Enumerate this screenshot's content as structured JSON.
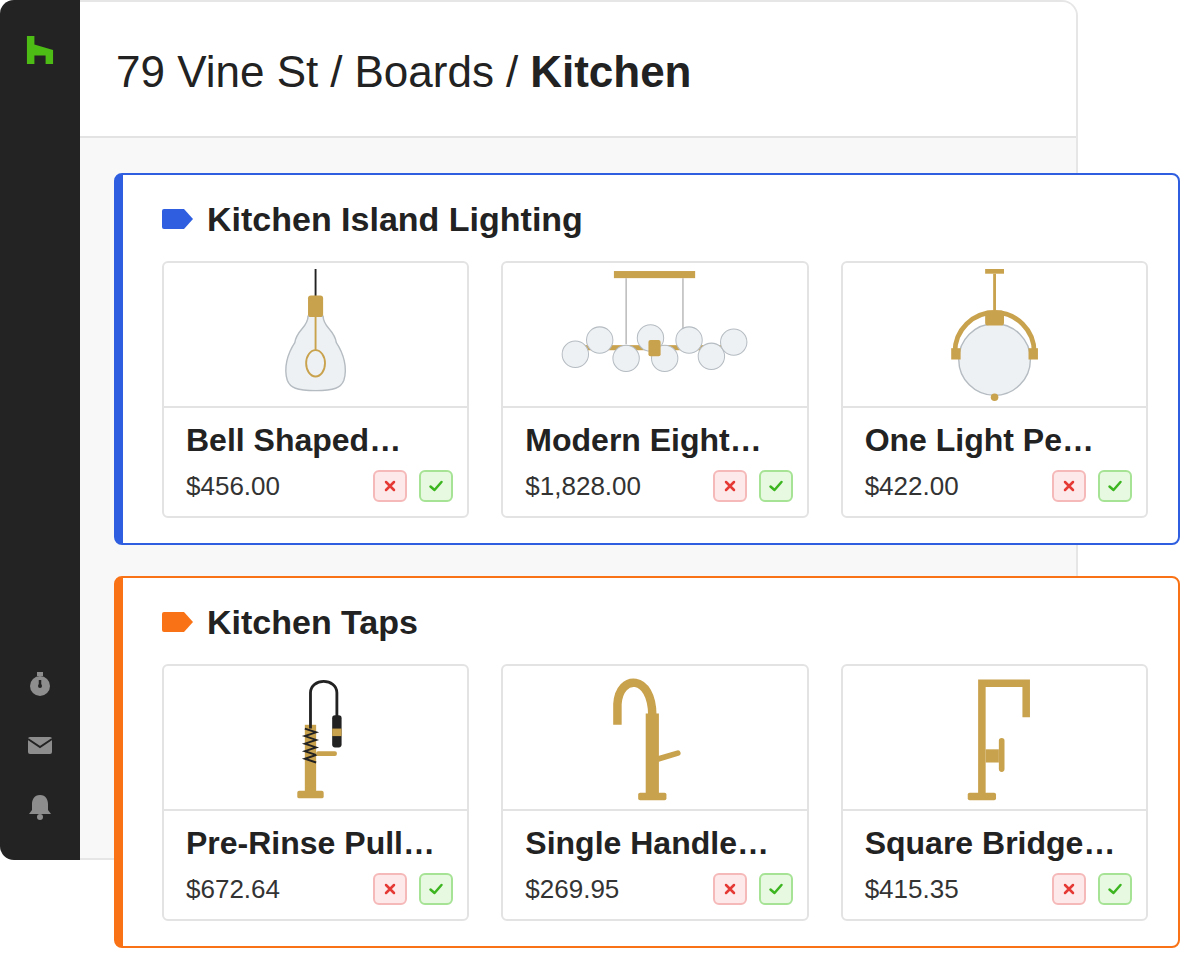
{
  "breadcrumb": {
    "separator": "/",
    "items": [
      {
        "label": "79 Vine St",
        "current": false
      },
      {
        "label": "Boards",
        "current": false
      },
      {
        "label": "Kitchen",
        "current": true
      }
    ]
  },
  "boards": [
    {
      "title": "Kitchen Island Lighting",
      "color": "#2f5fe0",
      "products": [
        {
          "name": "Bell Shaped…",
          "price": "$456.00"
        },
        {
          "name": "Modern Eight…",
          "price": "$1,828.00"
        },
        {
          "name": "One Light Pe…",
          "price": "$422.00"
        }
      ]
    },
    {
      "title": "Kitchen Taps",
      "color": "#f97316",
      "products": [
        {
          "name": "Pre-Rinse Pull…",
          "price": "$672.64"
        },
        {
          "name": "Single Handle…",
          "price": "$269.95"
        },
        {
          "name": "Square Bridge…",
          "price": "$415.35"
        }
      ]
    }
  ]
}
